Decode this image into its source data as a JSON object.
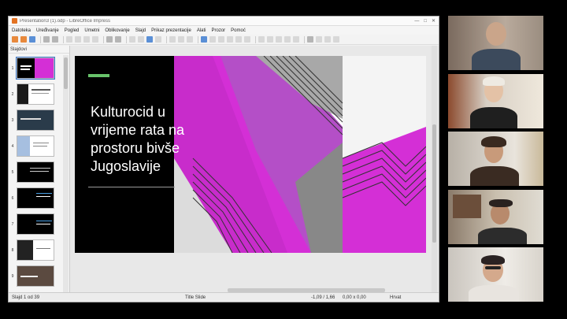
{
  "window": {
    "title": "Presentation3 (1).odp - LibreOffice Impress",
    "controls": [
      "—",
      "□",
      "✕"
    ]
  },
  "menu": [
    "Datoteka",
    "Uređivanje",
    "Pogled",
    "Umetni",
    "Oblikovanje",
    "Slajd",
    "Prikaz prezentacije",
    "Alati",
    "Prozor",
    "Pomoć"
  ],
  "slides_pane": {
    "header": "Slajdovi",
    "numbers": [
      "1",
      "2",
      "3",
      "4",
      "5",
      "6",
      "7",
      "8",
      "9"
    ]
  },
  "slide": {
    "title": "Kulturocid u vrijeme rata na prostoru bivše Jugoslavije",
    "colors": {
      "background": "#000000",
      "magenta": "#d42fd6",
      "accent": "#68c36a"
    }
  },
  "status": {
    "slide_count": "Slajd 1 od 39",
    "layout": "Title Slide",
    "position": "-1,09 / 1,66",
    "size": "0,00 x 0,00",
    "language": "Hrvat"
  },
  "participants": {
    "count": 5,
    "active_index": 2
  }
}
